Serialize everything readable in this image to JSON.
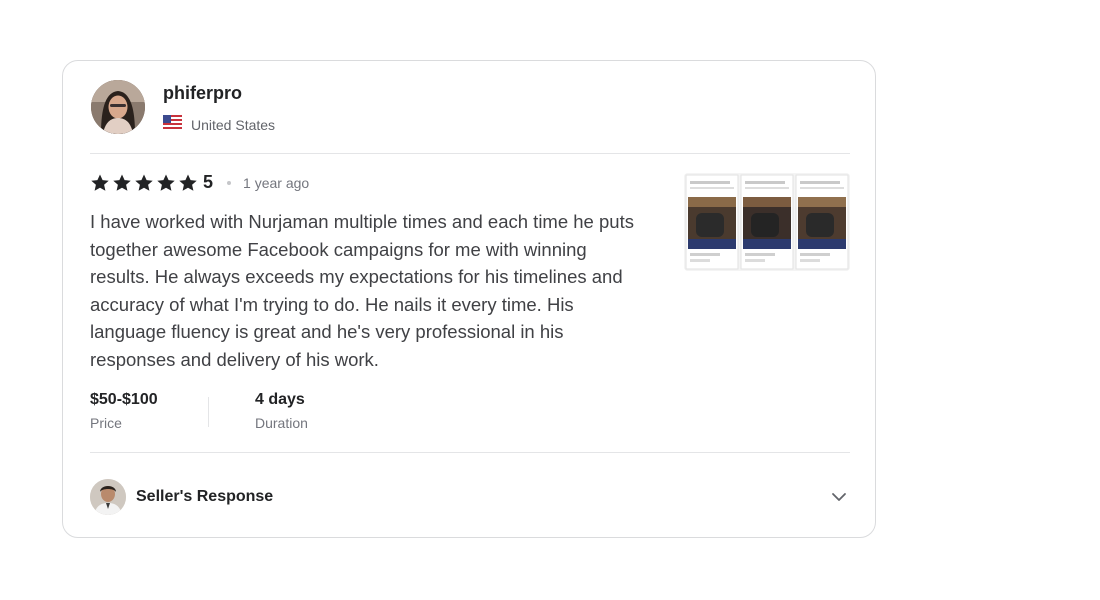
{
  "review": {
    "username": "phiferpro",
    "country": "United States",
    "rating": "5",
    "time_ago": "1 year ago",
    "text": "I have worked with Nurjaman multiple times and each time he puts together awesome Facebook campaigns for me with winning results. He always exceeds my expectations for his timelines and accuracy of what I'm trying to do. He nails it every time. His language fluency is great and he's very professional in his responses and delivery of his work.",
    "price": {
      "value": "$50-$100",
      "label": "Price"
    },
    "duration": {
      "value": "4 days",
      "label": "Duration"
    },
    "seller_response": {
      "label": "Seller's Response"
    }
  },
  "icons": {
    "flag": "us-flag-icon",
    "star": "star-icon",
    "chevron": "chevron-down-icon"
  },
  "colors": {
    "star": "#222325",
    "text": "#404145",
    "muted": "#74767e",
    "border": "#dadbdd"
  }
}
